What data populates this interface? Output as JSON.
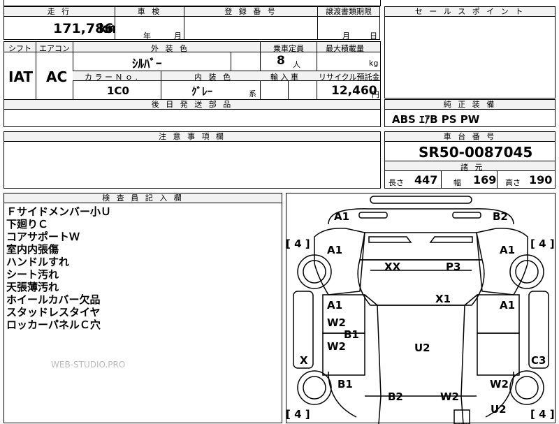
{
  "top": {
    "mileage_label": "走 行",
    "mileage": "171,786",
    "mileage_unit": "km",
    "inspection_label": "車 検",
    "year_unit": "年",
    "month_unit": "月",
    "reg_label": "登 録 番 号",
    "transfer_label": "譲渡書類期限",
    "transfer_month": "月",
    "transfer_day": "日"
  },
  "row2": {
    "shift_label": "シフト",
    "aircon_label": "エアコン",
    "color_label": "外 装 色",
    "capacity_label": "乗車定員",
    "max_load_label": "最大積載量",
    "shift": "IAT",
    "aircon": "AC",
    "color": "ｼﾙﾊﾞｰ",
    "capacity": "8",
    "capacity_unit": "人",
    "load_unit": "kg",
    "colorno_label": "カ ラ ー Ｎ ｏ .",
    "interior_label": "内 装 色",
    "import_label": "輸 入 車",
    "recycle_label": "リサイクル預託金",
    "colorno": "1C0",
    "interior": "ｸﾞﾚｰ",
    "interior_suffix": "系",
    "recycle": "12,460",
    "recycle_unit": "円"
  },
  "later": {
    "label": "後 日 発 送 部 品"
  },
  "sales": {
    "label": "セ ー ル ス ポ イ ン ト"
  },
  "equip": {
    "label": "純 正 装 備",
    "value": "ABS ｴｱB PS PW"
  },
  "notes": {
    "label": "注 意 事 項 欄"
  },
  "chassis": {
    "label": "車 台 番 号",
    "value": "SR50-0087045",
    "spec_label": "諸 元",
    "length_label": "長さ",
    "length": "447",
    "width_label": "幅",
    "width": "169",
    "height_label": "高さ",
    "height": "190"
  },
  "inspector": {
    "label": "検 査 員 記 入 欄",
    "lines": [
      "Ｆサイドメンバー小Ｕ",
      "下廻りＣ",
      "コアサポートＷ",
      "室内内張傷",
      "ハンドルすれ",
      "シート汚れ",
      "天張薄汚れ",
      "ホイールカバー欠品",
      "スタッドレスタイヤ",
      "ロッカーパネルＣ穴"
    ],
    "watermark": "WEB-STUDIO.PRO"
  },
  "map": {
    "labels": {
      "a1_top_left": "A1",
      "b2_top_right": "B2",
      "a1_left": "A1",
      "a1_right": "A1",
      "xx": "XX",
      "p3": "P3",
      "x1": "X1",
      "a1_mid_left": "A1",
      "a1_mid_right": "A1",
      "w2_left": "W2",
      "b1_left": "B1",
      "w2_left2": "W2",
      "u2_center": "U2",
      "x_left": "X",
      "c3_right": "C3",
      "b1_bottom_left": "B1",
      "w2_bottom_right": "W2",
      "b2_bottom": "B2",
      "w2_bottom": "W2",
      "u2_bottom": "U2"
    },
    "tread": {
      "tl": "4",
      "tr": "4",
      "bl": "4",
      "br": "4"
    }
  }
}
